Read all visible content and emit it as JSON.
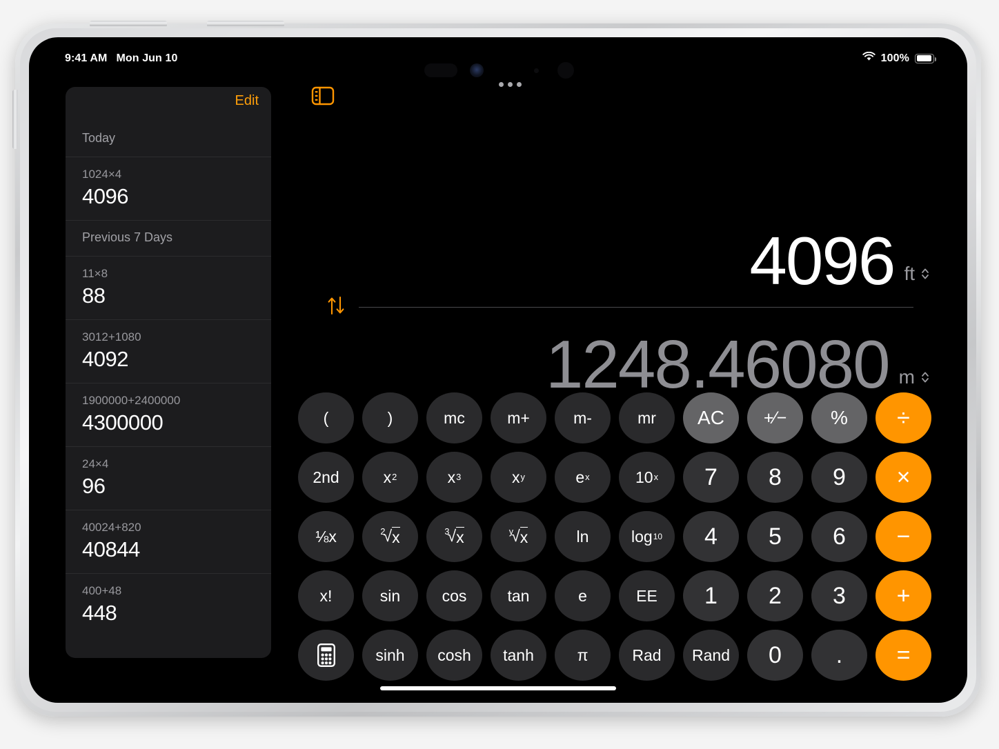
{
  "status_bar": {
    "time": "9:41 AM",
    "date": "Mon Jun 10",
    "wifi_icon": "wifi-icon",
    "battery_percent": "100%",
    "battery_icon": "battery-full-icon"
  },
  "multitask_button": {
    "icon": "three-dots-icon"
  },
  "sidebar": {
    "edit_label": "Edit",
    "toggle_icon": "sidebar-toggle-icon",
    "sections": [
      {
        "header": "Today",
        "items": [
          {
            "expression": "1024×4",
            "result": "4096"
          }
        ]
      },
      {
        "header": "Previous 7 Days",
        "items": [
          {
            "expression": "11×8",
            "result": "88"
          },
          {
            "expression": "3012+1080",
            "result": "4092"
          },
          {
            "expression": "1900000+2400000",
            "result": "4300000"
          },
          {
            "expression": "24×4",
            "result": "96"
          },
          {
            "expression": "40024+820",
            "result": "40844"
          },
          {
            "expression": "400+48",
            "result": "448"
          }
        ]
      }
    ]
  },
  "display": {
    "top_value": "4096",
    "top_unit": "ft",
    "bottom_value": "1248.46080",
    "bottom_unit": "m",
    "swap_icon": "swap-vertical-arrows-icon",
    "unit_chevron_icon": "chevron-up-down-icon"
  },
  "keypad": {
    "rows": [
      [
        {
          "label": "(",
          "type": "fn",
          "name": "key-open-paren"
        },
        {
          "label": ")",
          "type": "fn",
          "name": "key-close-paren"
        },
        {
          "label": "mc",
          "type": "fn",
          "name": "key-memory-clear"
        },
        {
          "label": "m+",
          "type": "fn",
          "name": "key-memory-add"
        },
        {
          "label": "m-",
          "type": "fn",
          "name": "key-memory-subtract"
        },
        {
          "label": "mr",
          "type": "fn",
          "name": "key-memory-recall"
        },
        {
          "label": "AC",
          "type": "util",
          "name": "key-all-clear"
        },
        {
          "label": "⁺⁄₋",
          "type": "util",
          "name": "key-plus-minus",
          "html": "<span style=\"font-size:25px\">&#43;&frasl;&minus;</span>"
        },
        {
          "label": "%",
          "type": "util",
          "name": "key-percent"
        },
        {
          "label": "÷",
          "type": "op",
          "name": "key-divide"
        }
      ],
      [
        {
          "label": "2nd",
          "type": "fn",
          "name": "key-second-function"
        },
        {
          "label": "x²",
          "type": "fn",
          "name": "key-x-squared",
          "html": "x<sup>2</sup>"
        },
        {
          "label": "x³",
          "type": "fn",
          "name": "key-x-cubed",
          "html": "x<sup>3</sup>"
        },
        {
          "label": "xʸ",
          "type": "fn",
          "name": "key-x-power-y",
          "html": "x<sup>y</sup>"
        },
        {
          "label": "eˣ",
          "type": "fn",
          "name": "key-e-power-x",
          "html": "e<sup>x</sup>"
        },
        {
          "label": "10ˣ",
          "type": "fn",
          "name": "key-ten-power-x",
          "html": "10<sup>x</sup>"
        },
        {
          "label": "7",
          "type": "num",
          "name": "key-7"
        },
        {
          "label": "8",
          "type": "num",
          "name": "key-8"
        },
        {
          "label": "9",
          "type": "num",
          "name": "key-9"
        },
        {
          "label": "×",
          "type": "op",
          "name": "key-multiply"
        }
      ],
      [
        {
          "label": "¹⁄x",
          "type": "fn",
          "name": "key-reciprocal",
          "html": "&#8539;x"
        },
        {
          "label": "²√x",
          "type": "fn",
          "name": "key-square-root",
          "html": "<span class=\"root-key\"><span class=\"root-idx\">2</span>&radic;<span style=\"border-top:1px solid currentColor;padding-top:1px\">x</span></span>"
        },
        {
          "label": "³√x",
          "type": "fn",
          "name": "key-cube-root",
          "html": "<span class=\"root-key\"><span class=\"root-idx\">3</span>&radic;<span style=\"border-top:1px solid currentColor;padding-top:1px\">x</span></span>"
        },
        {
          "label": "ʸ√x",
          "type": "fn",
          "name": "key-y-root",
          "html": "<span class=\"root-key\"><span class=\"root-idx\">y</span>&radic;<span style=\"border-top:1px solid currentColor;padding-top:1px\">x</span></span>"
        },
        {
          "label": "ln",
          "type": "fn",
          "name": "key-natural-log"
        },
        {
          "label": "log₁₀",
          "type": "fn",
          "name": "key-log-base-10",
          "html": "log<sub>10</sub>"
        },
        {
          "label": "4",
          "type": "num",
          "name": "key-4"
        },
        {
          "label": "5",
          "type": "num",
          "name": "key-5"
        },
        {
          "label": "6",
          "type": "num",
          "name": "key-6"
        },
        {
          "label": "−",
          "type": "op",
          "name": "key-subtract"
        }
      ],
      [
        {
          "label": "x!",
          "type": "fn",
          "name": "key-factorial"
        },
        {
          "label": "sin",
          "type": "fn",
          "name": "key-sine"
        },
        {
          "label": "cos",
          "type": "fn",
          "name": "key-cosine"
        },
        {
          "label": "tan",
          "type": "fn",
          "name": "key-tangent"
        },
        {
          "label": "e",
          "type": "fn",
          "name": "key-euler-number"
        },
        {
          "label": "EE",
          "type": "fn",
          "name": "key-exponent-entry"
        },
        {
          "label": "1",
          "type": "num",
          "name": "key-1"
        },
        {
          "label": "2",
          "type": "num",
          "name": "key-2"
        },
        {
          "label": "3",
          "type": "num",
          "name": "key-3"
        },
        {
          "label": "+",
          "type": "op",
          "name": "key-add"
        }
      ],
      [
        {
          "label": "",
          "type": "fn",
          "name": "key-calculator-mode",
          "icon": "calculator-icon"
        },
        {
          "label": "sinh",
          "type": "fn",
          "name": "key-hyperbolic-sine"
        },
        {
          "label": "cosh",
          "type": "fn",
          "name": "key-hyperbolic-cosine"
        },
        {
          "label": "tanh",
          "type": "fn",
          "name": "key-hyperbolic-tangent"
        },
        {
          "label": "π",
          "type": "fn",
          "name": "key-pi"
        },
        {
          "label": "Rad",
          "type": "fn",
          "name": "key-radians"
        },
        {
          "label": "Rand",
          "type": "fn",
          "name": "key-random"
        },
        {
          "label": "0",
          "type": "num",
          "name": "key-0"
        },
        {
          "label": ".",
          "type": "num",
          "name": "key-decimal-point"
        },
        {
          "label": "=",
          "type": "op eq",
          "name": "key-equals"
        }
      ]
    ]
  },
  "colors": {
    "accent_orange": "#ff9500",
    "edit_orange": "#ff9f0a",
    "key_function": "#2a2a2c",
    "key_number": "#323234",
    "key_util": "#646466",
    "sidebar_bg": "#1c1c1e",
    "screen_bg": "#000000",
    "secondary_text": "#8e8e93"
  }
}
